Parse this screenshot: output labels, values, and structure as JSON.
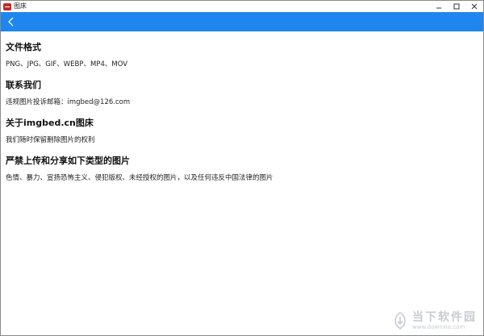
{
  "window": {
    "title": "图床"
  },
  "sections": [
    {
      "title": "文件格式",
      "body": "PNG、JPG、GIF、WEBP、MP4、MOV"
    },
    {
      "title": "联系我们",
      "body": "违规图片投诉邮箱：imgbed@126.com"
    },
    {
      "title": "关于imgbed.cn图床",
      "body": "我们随时保留删除图片的权利"
    },
    {
      "title": "严禁上传和分享如下类型的图片",
      "body": "色情、暴力、宣扬恐怖主义、侵犯版权、未经授权的图片，以及任何违反中国法律的图片"
    }
  ],
  "watermark": {
    "name": "当下软件园",
    "url": "www.downxia.com"
  },
  "colors": {
    "appbar": "#1f86f0",
    "window_border": "#8a8a8a"
  },
  "icons": [
    "app-icon",
    "minimize-icon",
    "maximize-icon",
    "close-icon",
    "back-arrow-icon",
    "watermark-logo-icon"
  ]
}
